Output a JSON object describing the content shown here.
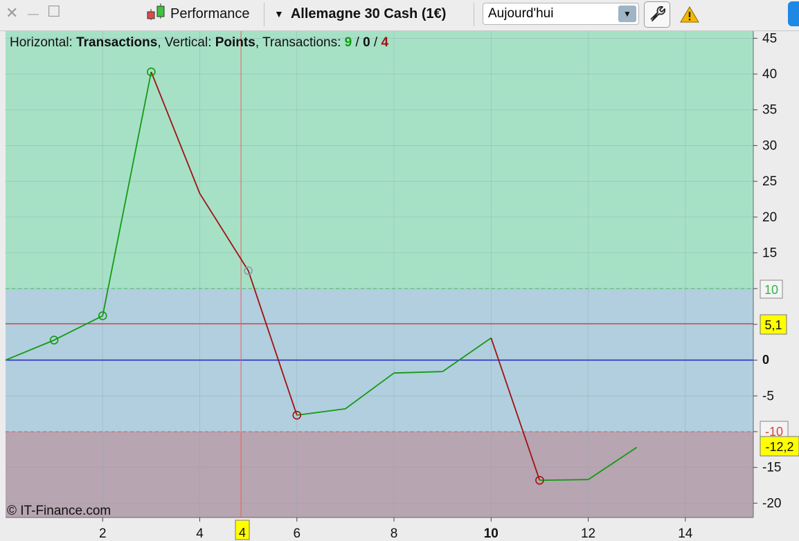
{
  "toolbar": {
    "close_glyph": "✕",
    "minimize_glyph": "—",
    "maximize_glyph": "☐",
    "performance_label": "Performance",
    "instrument_label": "Allemagne 30 Cash (1€)",
    "period_value": "Aujourd'hui",
    "icons": [
      "candlestick-icon",
      "dropdown-triangle-icon",
      "chevron-down-icon",
      "wrench-icon",
      "warning-icon"
    ]
  },
  "chart": {
    "header": {
      "h_prefix": "Horizontal: ",
      "h_value": "Transactions",
      "v_prefix": ", Vertical: ",
      "v_value": "Points",
      "t_prefix": ", Transactions: ",
      "wins": "9",
      "sep1": " / ",
      "neutral": "0",
      "sep2": " / ",
      "losses": "4"
    },
    "copyright": "© IT-Finance.com",
    "colors": {
      "win_zone": "#a6e1c6",
      "neutral_zone": "#b1cfde",
      "loss_zone": "#b7a5b1",
      "up": "#139a13",
      "down": "#a01010",
      "zero_line": "#2020c8",
      "avg_line": "#e64545",
      "cursor": "#ff5555",
      "badge": "#ffff00"
    },
    "cursor_x_label": "4",
    "upper_threshold_label": "10",
    "lower_threshold_label": "-10",
    "avg_label": "5,1",
    "last_label": "-12,2",
    "zero_label": "0"
  },
  "chart_data": {
    "type": "line",
    "xlabel": "Transactions",
    "ylabel": "Points",
    "xlim": [
      0,
      15.4
    ],
    "ylim": [
      -22,
      46
    ],
    "x_ticks": [
      "2",
      "4",
      "6",
      "8",
      "10",
      "12",
      "14"
    ],
    "y_ticks": [
      "45",
      "40",
      "35",
      "30",
      "25",
      "20",
      "15",
      "10",
      "5",
      "0",
      "-5",
      "-10",
      "-15",
      "-20"
    ],
    "zones": {
      "upper": 10,
      "lower": -10
    },
    "avg_line": 5.1,
    "cursor_x": 4.85,
    "series": [
      {
        "x": [
          0,
          1,
          2,
          3,
          4,
          5,
          6,
          7,
          8,
          9,
          10,
          11,
          12,
          13
        ],
        "y": [
          0,
          2.8,
          6.2,
          40.3,
          23.3,
          12.5,
          -7.7,
          -6.8,
          -1.8,
          -1.6,
          3.1,
          -16.8,
          -16.7,
          -12.2
        ],
        "markers": [
          1,
          2,
          3,
          5,
          6,
          11
        ]
      }
    ]
  }
}
